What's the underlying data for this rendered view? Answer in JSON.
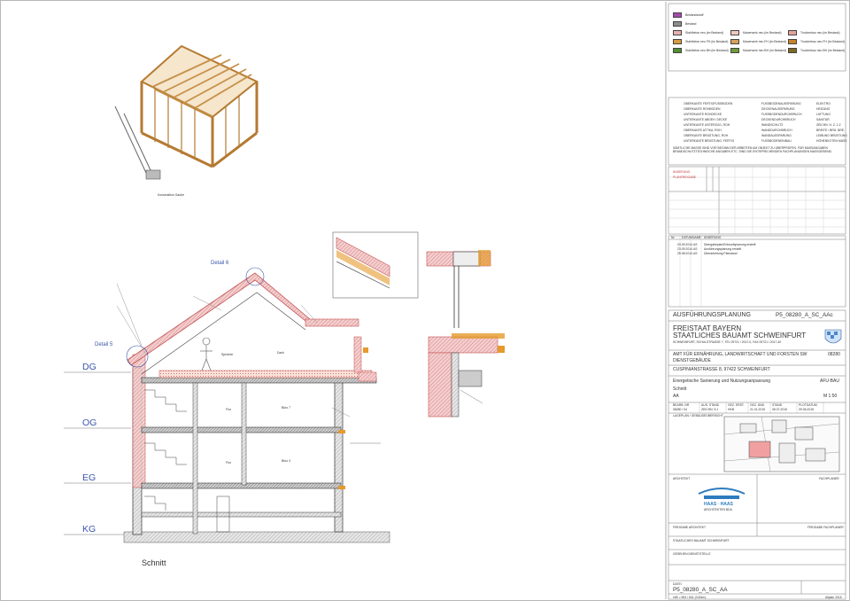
{
  "drawing": {
    "view_title": "Schnitt",
    "detail_labels": [
      "Detail 6",
      "Detail 5"
    ],
    "iso_caption": "Konstruktion Gaube",
    "levels": [
      "DG",
      "OG",
      "EG",
      "KG"
    ],
    "room_labels": [
      "Flur",
      "Büro 7",
      "Flur",
      "Büro 3",
      "Dach",
      "Speicher"
    ]
  },
  "legend": {
    "hatch_items": [
      {
        "label": "Bestandsstoff",
        "color": "#a64aaf"
      },
      {
        "label": "Bestand",
        "color": "#8d8d8d"
      },
      {
        "label": "Stahlbeton neu (im Bestand)",
        "color": "#e8b0b0"
      },
      {
        "label": "Stahlbeton neu FH (im Bestand)",
        "color": "#d79a3c"
      },
      {
        "label": "Stahlbeton neu BH (im Bestand)",
        "color": "#4e8f2e"
      },
      {
        "label": "Mauerwerk neu (im Bestand)",
        "color": "#f1c8c0"
      },
      {
        "label": "Mauerwerk neu FH (im Bestand)",
        "color": "#d9a05a"
      },
      {
        "label": "Mauerwerk neu BH (im Bestand)",
        "color": "#6f9b3a"
      },
      {
        "label": "Trockenbau neu (im Bestand)",
        "color": "#e6a39a"
      },
      {
        "label": "Trockenbau neu FH (im Bestand)",
        "color": "#c7832a"
      },
      {
        "label": "Trockenbau neu BH (im Bestand)",
        "color": "#7c6a22"
      }
    ],
    "symbols_left": [
      "OBERKANTE FERTIGFUSSBODEN",
      "OBERKANTE ROHBODEN",
      "UNTERKANTE ROHDECKE",
      "UNTERKANTE ABGEH. DECKE",
      "UNTERKANTE UNTERZUG, ROH",
      "OBERKANTE ATTIKA, ROH",
      "OBERKANTE BRÜSTUNG, ROH",
      "UNTERKANTE BRÜSTUNG, FERTIG"
    ],
    "symbols_mid": [
      "FUSSBODENAUSSPARUNG",
      "DECKENAUSSPARUNG",
      "FUSSBODENDURCHBRUCH",
      "DECKENDURCHBRUCH",
      "WANDSCHLITZ",
      "WANDDURCHBRUCH",
      "WANDAUSSPARUNG",
      "FUSSBODENEINBAU"
    ],
    "symbols_right": [
      "ELEKTRO",
      "HEIZUNG",
      "LÜFTUNG",
      "SANITÄR",
      "ZEICHN. H. Z. 1:2",
      "BREITE / BRÜ. BRE.",
      "LEIBUNG BRÜSTUNG",
      "HÖHENKOTEN MASS"
    ],
    "note": "SÄMTLICHE MASSE SIND VOR BEGINN DER ARBEITEN AM OBJEKT ZU ÜBERPRÜFEN. FÜR MASSANGABEN BRANDSCHUTZTECHNISCHE ANGABEN ETC. SIND DIE ENTSPRECHENDEN FACHPLANUNGEN MASSGEBEND."
  },
  "revisions": {
    "marker_labels": [
      "ÄNDERUNG",
      "PLANFREIGABE"
    ],
    "columns": [
      "Nr.",
      "DATUM",
      "NAME",
      "ÄNDERUNG"
    ],
    "rows": [
      {
        "date": "03.09.2014",
        "name": "AS",
        "text": "Übergabeplan/Entwurfsplanung erstellt"
      },
      {
        "date": "23.09.2014",
        "name": "AS",
        "text": "Ausführungsplanung erstellt"
      },
      {
        "date": "25.08.2014",
        "name": "AS",
        "text": "Überarbeitung Planstand"
      }
    ]
  },
  "title_block": {
    "phase": "AUSFÜHRUNGSPLANUNG",
    "plan_code": "P5_08280_A_SC_AAc",
    "authority_1": "FREISTAAT BAYERN",
    "authority_2": "STAATLICHES BAUAMT SCHWEINFURT",
    "address_line": "SCHWEINFURT, SCHULSTRASSE 7, TEL 09721 / 2017-0, FAX 09721 / 2017-40",
    "client": "AMT FÜR ERNÄHRUNG, LANDWIRTSCHAFT UND FORSTEN SW",
    "project_no": "08280",
    "building": "DIENSTGEBÄUDE",
    "street": "CUSPINIANSTRASSE 8, 97422 SCHWEINFURT",
    "measure": "Energetische Sanierung und Nutzungsanpassung",
    "dept": "AFU-BAU",
    "plan_type": "Schnitt",
    "section": "AA",
    "scale": "M 1:50",
    "meta_headers": [
      "BEARB. NR",
      "AUS. STAND",
      "GEZ. ERST.",
      "GEZ. ÄND.",
      "STAND",
      "PLOTDATUM"
    ],
    "meta_values": [
      "08280 / 04",
      "ZEICHN. 5.1",
      "HKB",
      "21.01.2015",
      "08.07.2015",
      "09.06.2015"
    ],
    "site_label": "LAGEPLAN / GEBÄUDEÜBERSICHT",
    "architect_label": "ARCHITEKT",
    "planner_label": "FACHPLANER",
    "architect_name": "HAAS · HAAS",
    "architect_sub": "ARCHITEKTEN BDA",
    "approval_1": "FREIGABE ARCHITEKT",
    "approval_2": "FREIGABE FACHPLANER",
    "approval_3": "STAATLICHES BAUAMT SCHWEINFURT",
    "approval_4": "GESEHEN DIENSTSTELLE",
    "file_label": "DATEI",
    "file_name": "P5_08280_A_SC_AA",
    "sheet_size": "H/B = 594 / 841 (0.50m²)",
    "software": "Allplan 2015"
  }
}
